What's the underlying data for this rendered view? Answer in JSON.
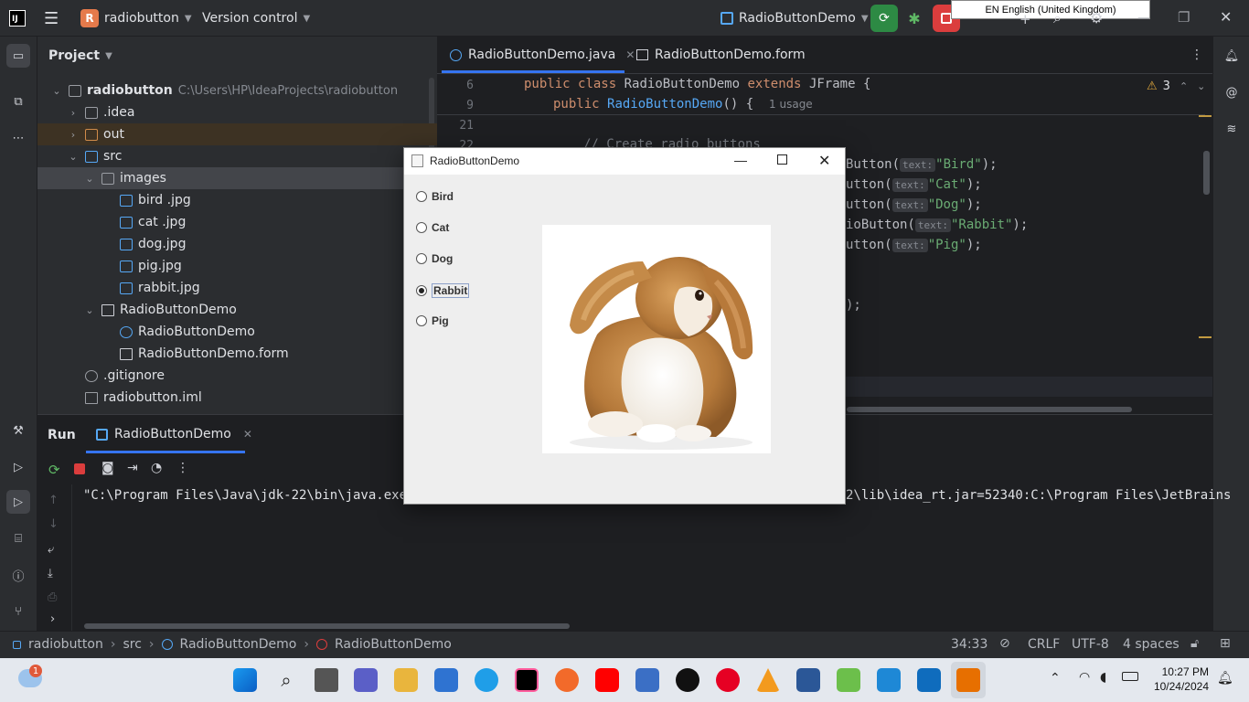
{
  "titlebar": {
    "project_name": "radiobutton",
    "project_letter": "R",
    "vcs_label": "Version control",
    "run_config": "RadioButtonDemo",
    "lang_tooltip": "EN English (United Kingdom)"
  },
  "project_panel": {
    "title": "Project",
    "tree": [
      {
        "label": "radiobutton",
        "extra": "C:\\Users\\HP\\IdeaProjects\\radiobutton"
      },
      {
        "label": ".idea"
      },
      {
        "label": "out"
      },
      {
        "label": "src"
      },
      {
        "label": "images"
      },
      {
        "label": "bird .jpg"
      },
      {
        "label": "cat .jpg"
      },
      {
        "label": "dog.jpg"
      },
      {
        "label": "pig.jpg"
      },
      {
        "label": "rabbit.jpg"
      },
      {
        "label": "RadioButtonDemo"
      },
      {
        "label": "RadioButtonDemo"
      },
      {
        "label": "RadioButtonDemo.form"
      },
      {
        "label": ".gitignore"
      },
      {
        "label": "radiobutton.iml"
      }
    ]
  },
  "editor": {
    "tabs": [
      {
        "label": "RadioButtonDemo.java"
      },
      {
        "label": "RadioButtonDemo.form"
      }
    ],
    "warnings": "3",
    "line_numbers": [
      "6",
      "9",
      "21",
      "22"
    ],
    "line6": {
      "kw1": "public",
      "kw2": "class",
      "cls": "RadioButtonDemo",
      "kw3": "extends",
      "sup": "JFrame {"
    },
    "line9": {
      "kw1": "public",
      "fn": "RadioButtonDemo",
      "rest": "() {",
      "usage": "1 usage"
    },
    "comment": "// Create radio buttons",
    "calls": [
      {
        "prefix": "Button(",
        "hint": "text:",
        "arg": "\"Bird\"",
        "end": ");"
      },
      {
        "prefix": "utton(",
        "hint": "text:",
        "arg": "\"Cat\"",
        "end": ");"
      },
      {
        "prefix": "utton(",
        "hint": "text:",
        "arg": "\"Dog\"",
        "end": ");"
      },
      {
        "prefix": "ioButton(",
        "hint": "text:",
        "arg": "\"Rabbit\"",
        "end": ");"
      },
      {
        "prefix": "utton(",
        "hint": "text:",
        "arg": "\"Pig\"",
        "end": ");"
      }
    ],
    "closing": ");"
  },
  "run_panel": {
    "title": "Run",
    "tab_label": "RadioButtonDemo",
    "console_left": "\"C:\\Program Files\\Java\\jdk-22\\bin\\java.exe\"",
    "console_right": "2\\lib\\idea_rt.jar=52340:C:\\Program Files\\JetBrains"
  },
  "statusbar": {
    "crumbs": [
      "radiobutton",
      "src",
      "RadioButtonDemo",
      "RadioButtonDemo"
    ],
    "position": "34:33",
    "line_sep": "CRLF",
    "encoding": "UTF-8",
    "indent": "4 spaces"
  },
  "swing_window": {
    "title": "RadioButtonDemo",
    "options": [
      {
        "label": "Bird",
        "selected": false
      },
      {
        "label": "Cat",
        "selected": false
      },
      {
        "label": "Dog",
        "selected": false
      },
      {
        "label": "Rabbit",
        "selected": true
      },
      {
        "label": "Pig",
        "selected": false
      }
    ],
    "image_subject": "rabbit"
  },
  "taskbar": {
    "time": "10:27 PM",
    "date": "10/24/2024",
    "weather_badge": "1"
  },
  "colors": {
    "accent": "#3574f0",
    "run_green": "#2d8a44",
    "stop_red": "#db3d3d",
    "string": "#6aab73",
    "keyword": "#cf8e6d",
    "function": "#56a8f5"
  }
}
